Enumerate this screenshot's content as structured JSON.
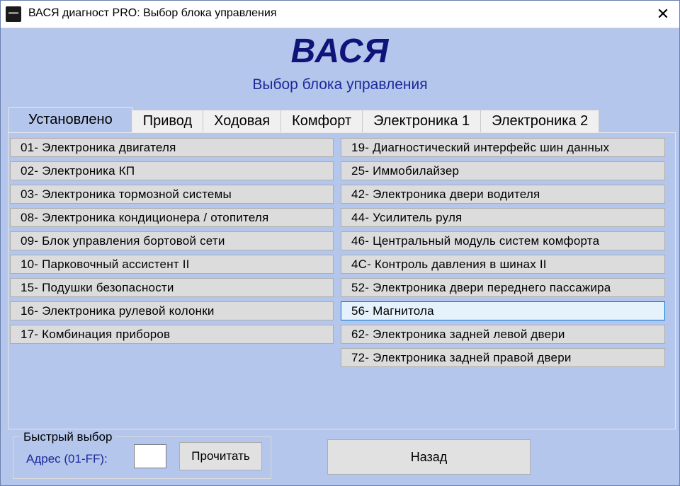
{
  "window": {
    "title": "ВАСЯ диагност PRO:  Выбор блока управления",
    "close_glyph": "✕"
  },
  "header": {
    "logo": "ВАСЯ",
    "subtitle": "Выбор блока управления"
  },
  "tabs": [
    {
      "label": "Установлено",
      "active": true
    },
    {
      "label": "Привод"
    },
    {
      "label": "Ходовая"
    },
    {
      "label": "Комфорт"
    },
    {
      "label": "Электроника 1"
    },
    {
      "label": "Электроника 2"
    }
  ],
  "modules": {
    "left": [
      "01- Электроника двигателя",
      "02- Электроника КП",
      "03- Электроника тормозной системы",
      "08- Электроника кондиционера / отопителя",
      "09- Блок управления бортовой сети",
      "10- Парковочный ассистент II",
      "15- Подушки безопасности",
      "16- Электроника рулевой колонки",
      "17- Комбинация приборов"
    ],
    "right": [
      "19- Диагностический интерфейс шин данных",
      "25- Иммобилайзер",
      "42- Электроника двери водителя",
      "44- Усилитель руля",
      "46- Центральный модуль систем комфорта",
      "4C- Контроль давления в шинах II",
      "52- Электроника двери переднего пассажира",
      "56- Магнитола",
      "62- Электроника задней левой двери",
      "72- Электроника задней правой двери"
    ],
    "selected": "56- Магнитола"
  },
  "quick_select": {
    "legend": "Быстрый выбор",
    "address_label": "Адрес (01-FF):",
    "address_value": "",
    "read_button": "Прочитать"
  },
  "back_button": "Назад"
}
